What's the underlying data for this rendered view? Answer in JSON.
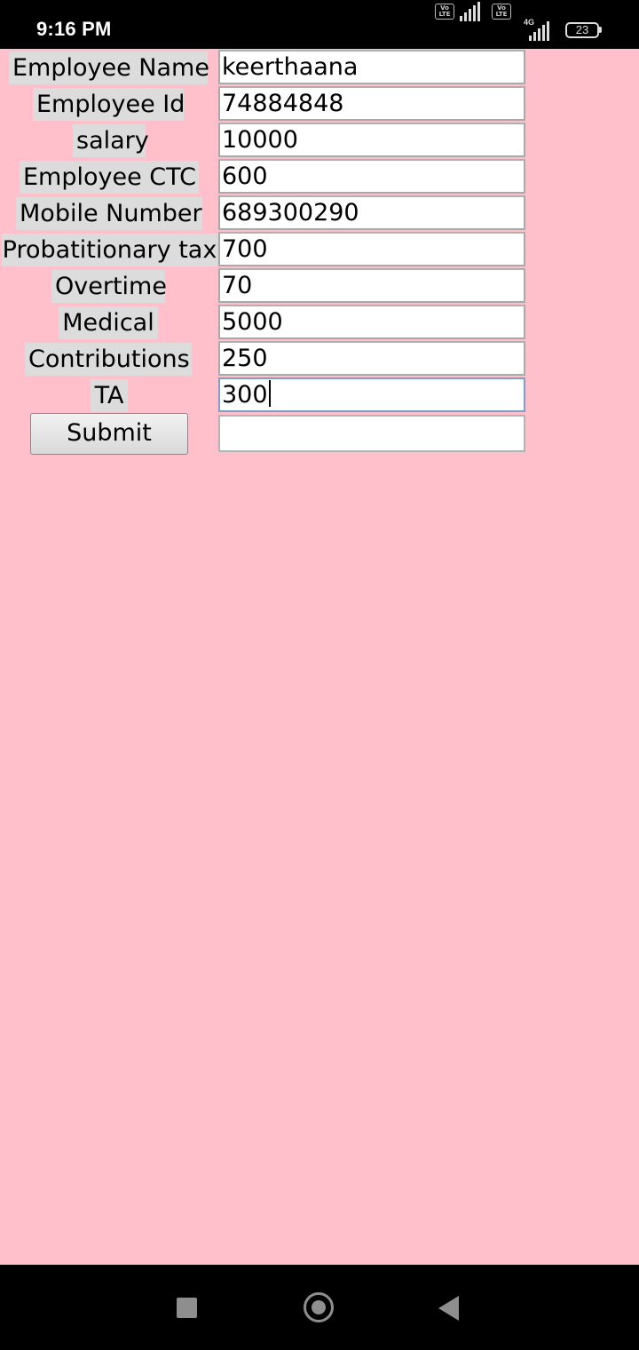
{
  "status_bar": {
    "time": "9:16 PM",
    "volte_label": "Vo LTE",
    "network_type": "4G",
    "battery_level": "23"
  },
  "form": {
    "fields": [
      {
        "label": "Employee Name",
        "value": "keerthaana"
      },
      {
        "label": "Employee Id",
        "value": "74884848"
      },
      {
        "label": "salary",
        "value": "10000"
      },
      {
        "label": "Employee CTC",
        "value": "600"
      },
      {
        "label": "Mobile Number",
        "value": "689300290"
      },
      {
        "label": "Probatitionary tax",
        "value": "700"
      },
      {
        "label": "Overtime",
        "value": "70"
      },
      {
        "label": "Medical",
        "value": "5000"
      },
      {
        "label": "Contributions",
        "value": "250"
      },
      {
        "label": "TA",
        "value": "300"
      }
    ],
    "submit_label": "Submit",
    "result_value": ""
  },
  "nav_bar": {
    "icons": [
      "recents-icon",
      "home-icon",
      "back-icon"
    ]
  },
  "colors": {
    "background": "#ffc0cb",
    "label_background": "#dcdcdc",
    "status_bar": "#000000",
    "focus_border": "#7b9fc9"
  }
}
